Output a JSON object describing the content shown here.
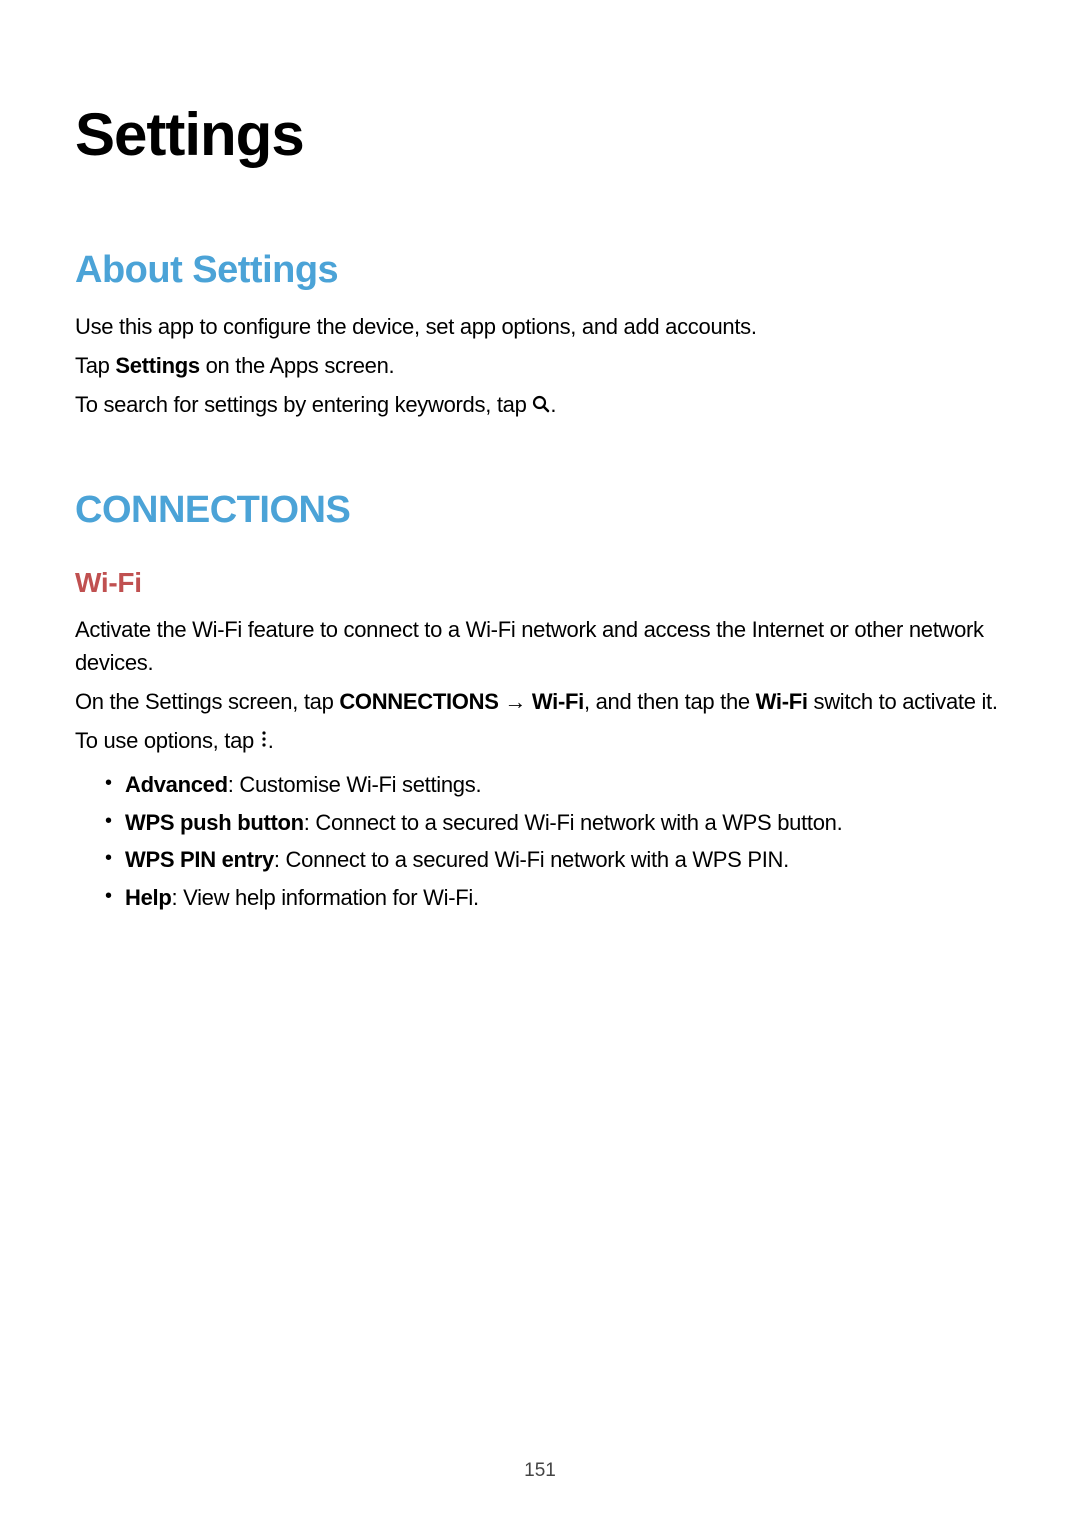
{
  "page": {
    "title": "Settings",
    "page_number": "151"
  },
  "about": {
    "heading": "About Settings",
    "line1": "Use this app to configure the device, set app options, and add accounts.",
    "line2_prefix": "Tap ",
    "line2_bold": "Settings",
    "line2_suffix": " on the Apps screen.",
    "line3_prefix": "To search for settings by entering keywords, tap ",
    "line3_suffix": "."
  },
  "connections": {
    "heading": "CONNECTIONS",
    "wifi": {
      "heading": "Wi-Fi",
      "para1": "Activate the Wi-Fi feature to connect to a Wi-Fi network and access the Internet or other network devices.",
      "para2_prefix": "On the Settings screen, tap ",
      "para2_bold1": "CONNECTIONS",
      "para2_arrow": " → ",
      "para2_bold2": "Wi-Fi",
      "para2_mid": ", and then tap the ",
      "para2_bold3": "Wi-Fi",
      "para2_suffix": " switch to activate it.",
      "para3_prefix": "To use options, tap ",
      "para3_suffix": ".",
      "bullets": [
        {
          "bold": "Advanced",
          "rest": ": Customise Wi-Fi settings."
        },
        {
          "bold": "WPS push button",
          "rest": ": Connect to a secured Wi-Fi network with a WPS button."
        },
        {
          "bold": "WPS PIN entry",
          "rest": ": Connect to a secured Wi-Fi network with a WPS PIN."
        },
        {
          "bold": "Help",
          "rest": ": View help information for Wi-Fi."
        }
      ]
    }
  }
}
